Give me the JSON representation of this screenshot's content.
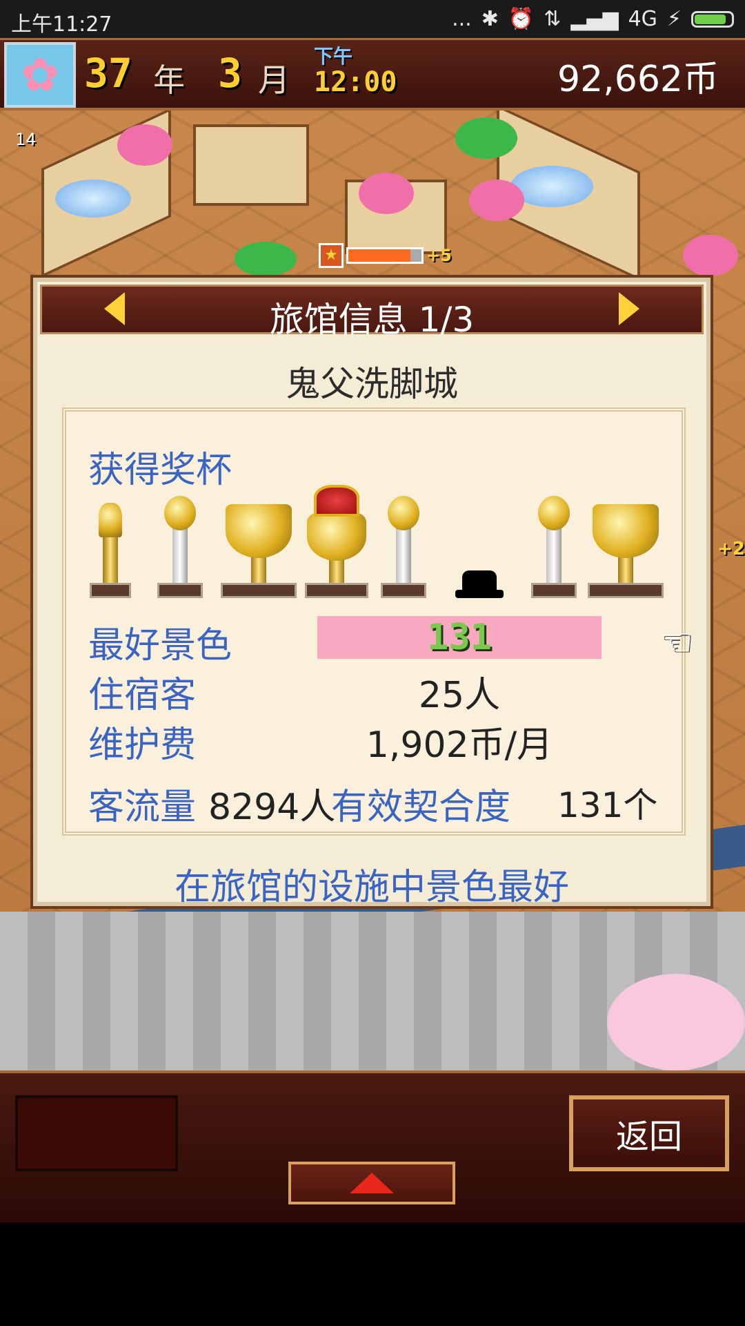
{
  "status_bar": {
    "time": "上午11:27",
    "dots": "...",
    "network": "4G",
    "icons": [
      "bluetooth-icon",
      "alarm-icon",
      "data-icon",
      "signal-icon",
      "charging-icon",
      "battery-icon"
    ]
  },
  "hud": {
    "year_value": "37",
    "year_unit": "年",
    "month_value": "3",
    "month_unit": "月",
    "ampm": "下午",
    "clock": "12:00",
    "money": "92,662币"
  },
  "world": {
    "room_number": "14",
    "level_plus": "+5",
    "side_plus": "+2",
    "level_progress": 0.85
  },
  "dialog": {
    "title": "旅馆信息 1/3",
    "inn_name": "鬼父洗脚城",
    "trophies_label": "获得奖杯",
    "trophies": [
      "gold-torch",
      "silver-trophy",
      "gold-cup",
      "gold-crown-cup",
      "silver-trophy",
      "black-hat",
      "silver-trophy",
      "gold-cup"
    ],
    "best_scenery_label": "最好景色",
    "best_scenery_value": "131",
    "guests_label": "住宿客",
    "guests_value": "25人",
    "maintenance_label": "维护费",
    "maintenance_value": "1,902币/月",
    "traffic_label": "客流量",
    "traffic_value": "8294人",
    "compat_label": "有效契合度",
    "compat_value": "131个",
    "description": "在旅馆的设施中景色最好"
  },
  "bottom": {
    "back_label": "返回"
  },
  "colors": {
    "label_blue": "#3a64c4",
    "hud_yellow": "#ffcf30",
    "header_brown": "#5a2418",
    "scenery_pink": "#f8a8c0",
    "scenery_green": "#7ac850"
  }
}
